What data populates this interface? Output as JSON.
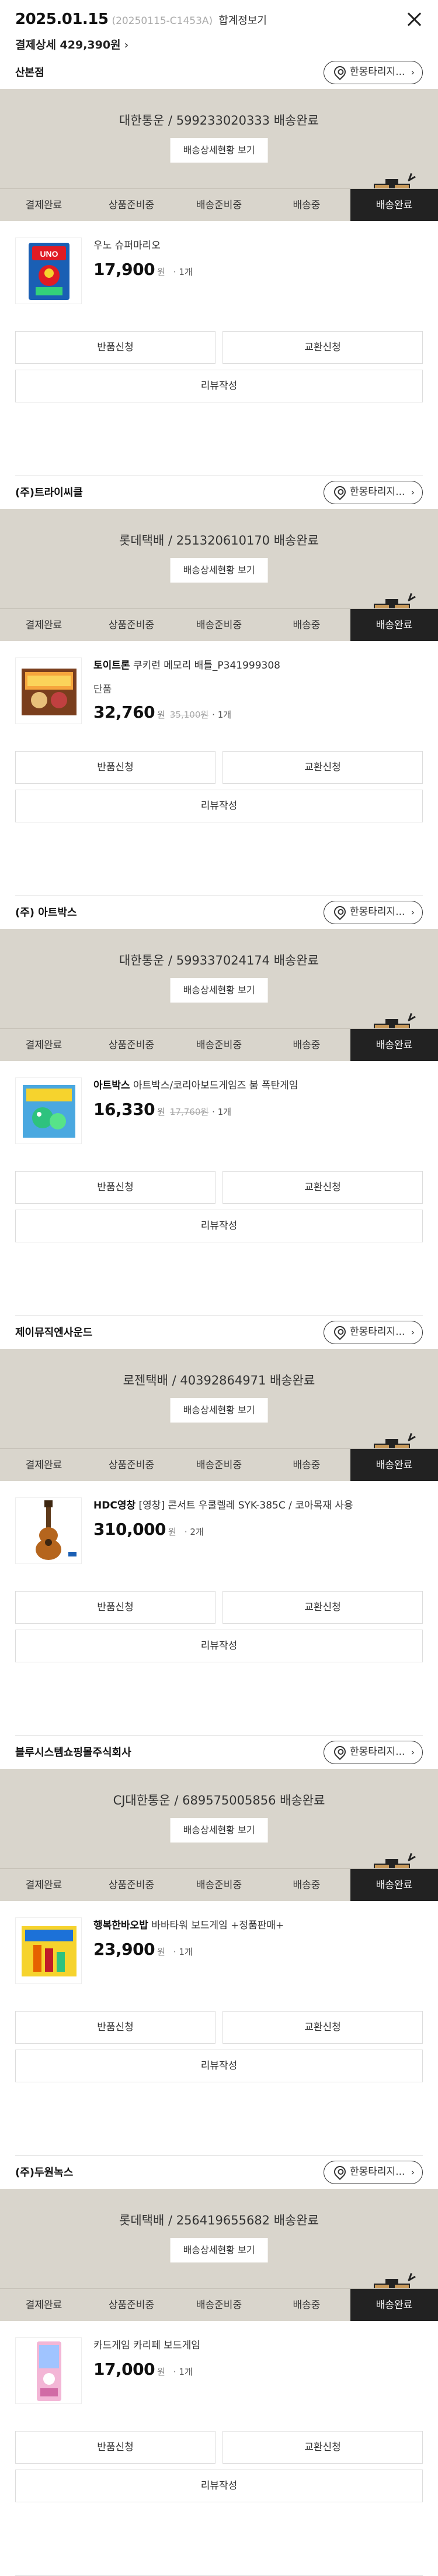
{
  "header": {
    "date": "2025.01.15",
    "order_no": "(20250115-C1453A)",
    "merge_view": "합계정보기",
    "payment_detail": "결제상세 429,390원",
    "payment_chevron": "›"
  },
  "steps": [
    "결제완료",
    "상품준비중",
    "배송준비중",
    "배송중",
    "배송완료"
  ],
  "detail_button": "배송상세현황 보기",
  "return_label": "한몽타리지...",
  "colors": {
    "status_bg": "#d9d5cc",
    "active_step": "#222222"
  },
  "orders": [
    {
      "seller": "산본점",
      "carrier": "대한통운 / 599233020333 배송완료",
      "product_brand": "",
      "product_name": "우노 슈퍼마리오",
      "option": "",
      "price": "17,900",
      "won": "원",
      "original_price": "",
      "qty": "· 1개",
      "thumb_icon": "uno-card-game-box"
    },
    {
      "seller": "(주)트라이씨클",
      "carrier": "롯데택배 / 251320610170 배송완료",
      "product_brand": "토이트론",
      "product_name": " 쿠키런 메모리 배틀_P341999308",
      "option": "단품",
      "price": "32,760",
      "won": "원",
      "original_price": "35,100원",
      "qty": "· 1개",
      "thumb_icon": "cookie-run-game-box"
    },
    {
      "seller": "(주) 아트박스",
      "carrier": "대한통운 / 599337024174 배송완료",
      "product_brand": "아트박스",
      "product_name": " 아트박스/코리아보드게임즈 붐 폭탄게임",
      "option": "",
      "price": "16,330",
      "won": "원",
      "original_price": "17,760원",
      "qty": "· 1개",
      "thumb_icon": "bomb-game-box"
    },
    {
      "seller": "제이뮤직엔사운드",
      "carrier": "로젠택배 / 40392864971 배송완료",
      "product_brand": "HDC영창",
      "product_name": " [영창] 콘서트 우쿨렐레 SYK-385C / 코아목재 사용",
      "option": "",
      "price": "310,000",
      "won": "원",
      "original_price": "",
      "qty": "· 2개",
      "thumb_icon": "ukulele-image"
    },
    {
      "seller": "블루시스템쇼핑몰주식회사",
      "carrier": "CJ대한통운 / 689575005856 배송완료",
      "product_brand": "행복한바오밥",
      "product_name": " 바바타워 보드게임 +정품판매+",
      "option": "",
      "price": "23,900",
      "won": "원",
      "original_price": "",
      "qty": "· 1개",
      "thumb_icon": "tower-game-box"
    },
    {
      "seller": "(주)두원녹스",
      "carrier": "롯데택배 / 256419655682 배송완료",
      "product_brand": "",
      "product_name": "카드게임 카리페 보드게임",
      "option": "",
      "price": "17,000",
      "won": "원",
      "original_price": "",
      "qty": "· 1개",
      "thumb_icon": "card-game-box"
    }
  ],
  "buttons": {
    "return": "반품신청",
    "exchange": "교환신청",
    "review": "리뷰작성"
  }
}
